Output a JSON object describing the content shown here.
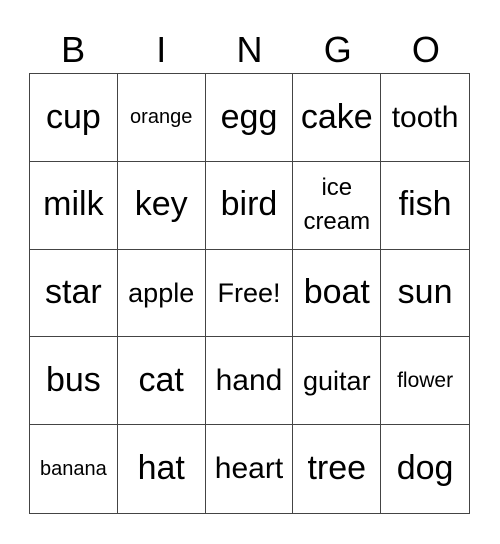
{
  "header": [
    "B",
    "I",
    "N",
    "G",
    "O"
  ],
  "cells": [
    [
      "cup",
      "orange",
      "egg",
      "cake",
      "tooth"
    ],
    [
      "milk",
      "key",
      "bird",
      "ice cream",
      "fish"
    ],
    [
      "star",
      "apple",
      "Free!",
      "boat",
      "sun"
    ],
    [
      "bus",
      "cat",
      "hand",
      "guitar",
      "flower"
    ],
    [
      "banana",
      "hat",
      "heart",
      "tree",
      "dog"
    ]
  ]
}
